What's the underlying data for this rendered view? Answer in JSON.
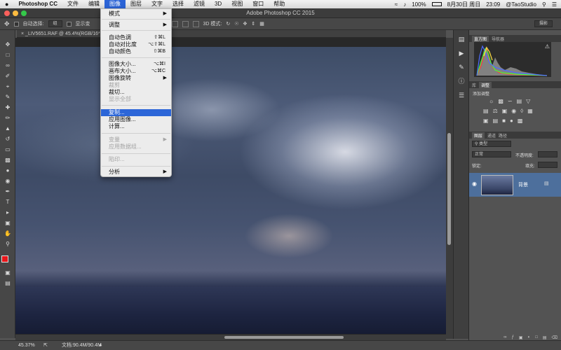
{
  "menubar": {
    "apple_icon": "apple-icon",
    "items": [
      "Photoshop CC",
      "文件",
      "编辑",
      "图像",
      "图层",
      "文字",
      "选择",
      "滤镜",
      "3D",
      "视图",
      "窗口",
      "帮助"
    ],
    "status": {
      "battery": "100%",
      "date": "8月30日 周日",
      "time": "23:09",
      "user": "@TaoStudio"
    }
  },
  "window": {
    "title": "Adobe Photoshop CC 2015"
  },
  "options_bar": {
    "auto_select_label": "自动选择:",
    "auto_select_value": "组",
    "show_transform_label": "显示变",
    "threed_mode": "3D 模式:",
    "workspace": "摄影"
  },
  "document": {
    "tab": "_LIV5651.RAF @ 45.4%(RGB/16*)",
    "zoom": "45.37%",
    "doc_size": "文档:90.4M/90.4M"
  },
  "image_menu": {
    "items": [
      {
        "label": "模式",
        "submenu": true
      },
      {
        "label": "调整",
        "submenu": true
      },
      {
        "label": "自动色调",
        "shortcut": "⇧⌘L"
      },
      {
        "label": "自动对比度",
        "shortcut": "⌥⇧⌘L"
      },
      {
        "label": "自动颜色",
        "shortcut": "⇧⌘B"
      },
      {
        "label": "图像大小...",
        "shortcut": "⌥⌘I"
      },
      {
        "label": "画布大小...",
        "shortcut": "⌥⌘C"
      },
      {
        "label": "图像旋转",
        "submenu": true
      },
      {
        "label": "裁剪",
        "disabled": true
      },
      {
        "label": "裁切..."
      },
      {
        "label": "显示全部",
        "disabled": true
      },
      {
        "label": "复制...",
        "highlighted": true
      },
      {
        "label": "应用图像..."
      },
      {
        "label": "计算..."
      },
      {
        "label": "变量",
        "submenu": true,
        "disabled": true
      },
      {
        "label": "应用数据组...",
        "disabled": true
      },
      {
        "label": "陷印...",
        "disabled": true
      },
      {
        "label": "分析",
        "submenu": true
      }
    ]
  },
  "panels": {
    "histogram_tabs": [
      "直方图",
      "导航器"
    ],
    "adjust_tabs": [
      "库",
      "调整"
    ],
    "adjust_title": "添加调整",
    "layer_tabs": [
      "图层",
      "通道",
      "路径"
    ],
    "layer_filter": "类型",
    "blend_mode": "正常",
    "opacity_label": "不透明度:",
    "lock_label": "锁定:",
    "fill_label": "填充:",
    "layer_name": "背景"
  }
}
